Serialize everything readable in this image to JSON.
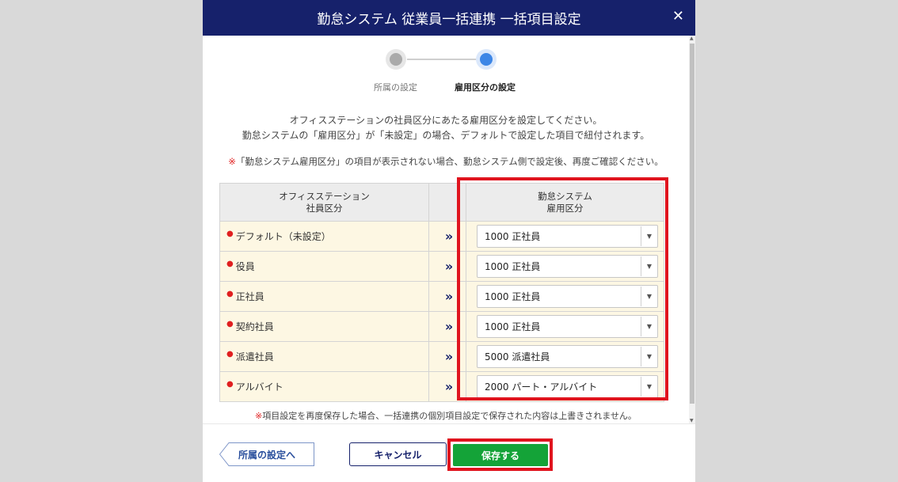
{
  "dialog": {
    "title": "勤怠システム 従業員一括連携 一括項目設定",
    "close_glyph": "✕"
  },
  "steps": [
    {
      "label": "所属の設定",
      "state": "done"
    },
    {
      "label": "雇用区分の設定",
      "state": "current"
    }
  ],
  "description": {
    "line1": "オフィスステーションの社員区分にあたる雇用区分を設定してください。",
    "line2": "勤怠システムの「雇用区分」が「未設定」の場合、デフォルトで設定した項目で紐付されます。",
    "note_mark": "※",
    "note": "「勤怠システム雇用区分」の項目が表示されない場合、勤怠システム側で設定後、再度ご確認ください。"
  },
  "table": {
    "left_header_line1": "オフィスステーション",
    "left_header_line2": "社員区分",
    "right_header_line1": "勤怠システム",
    "right_header_line2": "雇用区分",
    "rows": [
      {
        "label": "デフォルト（未設定）",
        "value": "1000 正社員"
      },
      {
        "label": "役員",
        "value": "1000 正社員"
      },
      {
        "label": "正社員",
        "value": "1000 正社員"
      },
      {
        "label": "契約社員",
        "value": "1000 正社員"
      },
      {
        "label": "派遣社員",
        "value": "5000 派遣社員"
      },
      {
        "label": "アルバイト",
        "value": "2000 パート・アルバイト"
      }
    ],
    "arrow_glyph": "»"
  },
  "bottom_note": {
    "mark": "※",
    "text": "項目設定を再度保存した場合、一括連携の個別項目設定で保存された内容は上書きされません。"
  },
  "footer": {
    "back_label": "所属の設定へ",
    "cancel_label": "キャンセル",
    "save_label": "保存する"
  },
  "colors": {
    "header_bg": "#16216b",
    "save_bg": "#14a338",
    "highlight": "#e0141e",
    "step_current": "#3d86e6"
  }
}
